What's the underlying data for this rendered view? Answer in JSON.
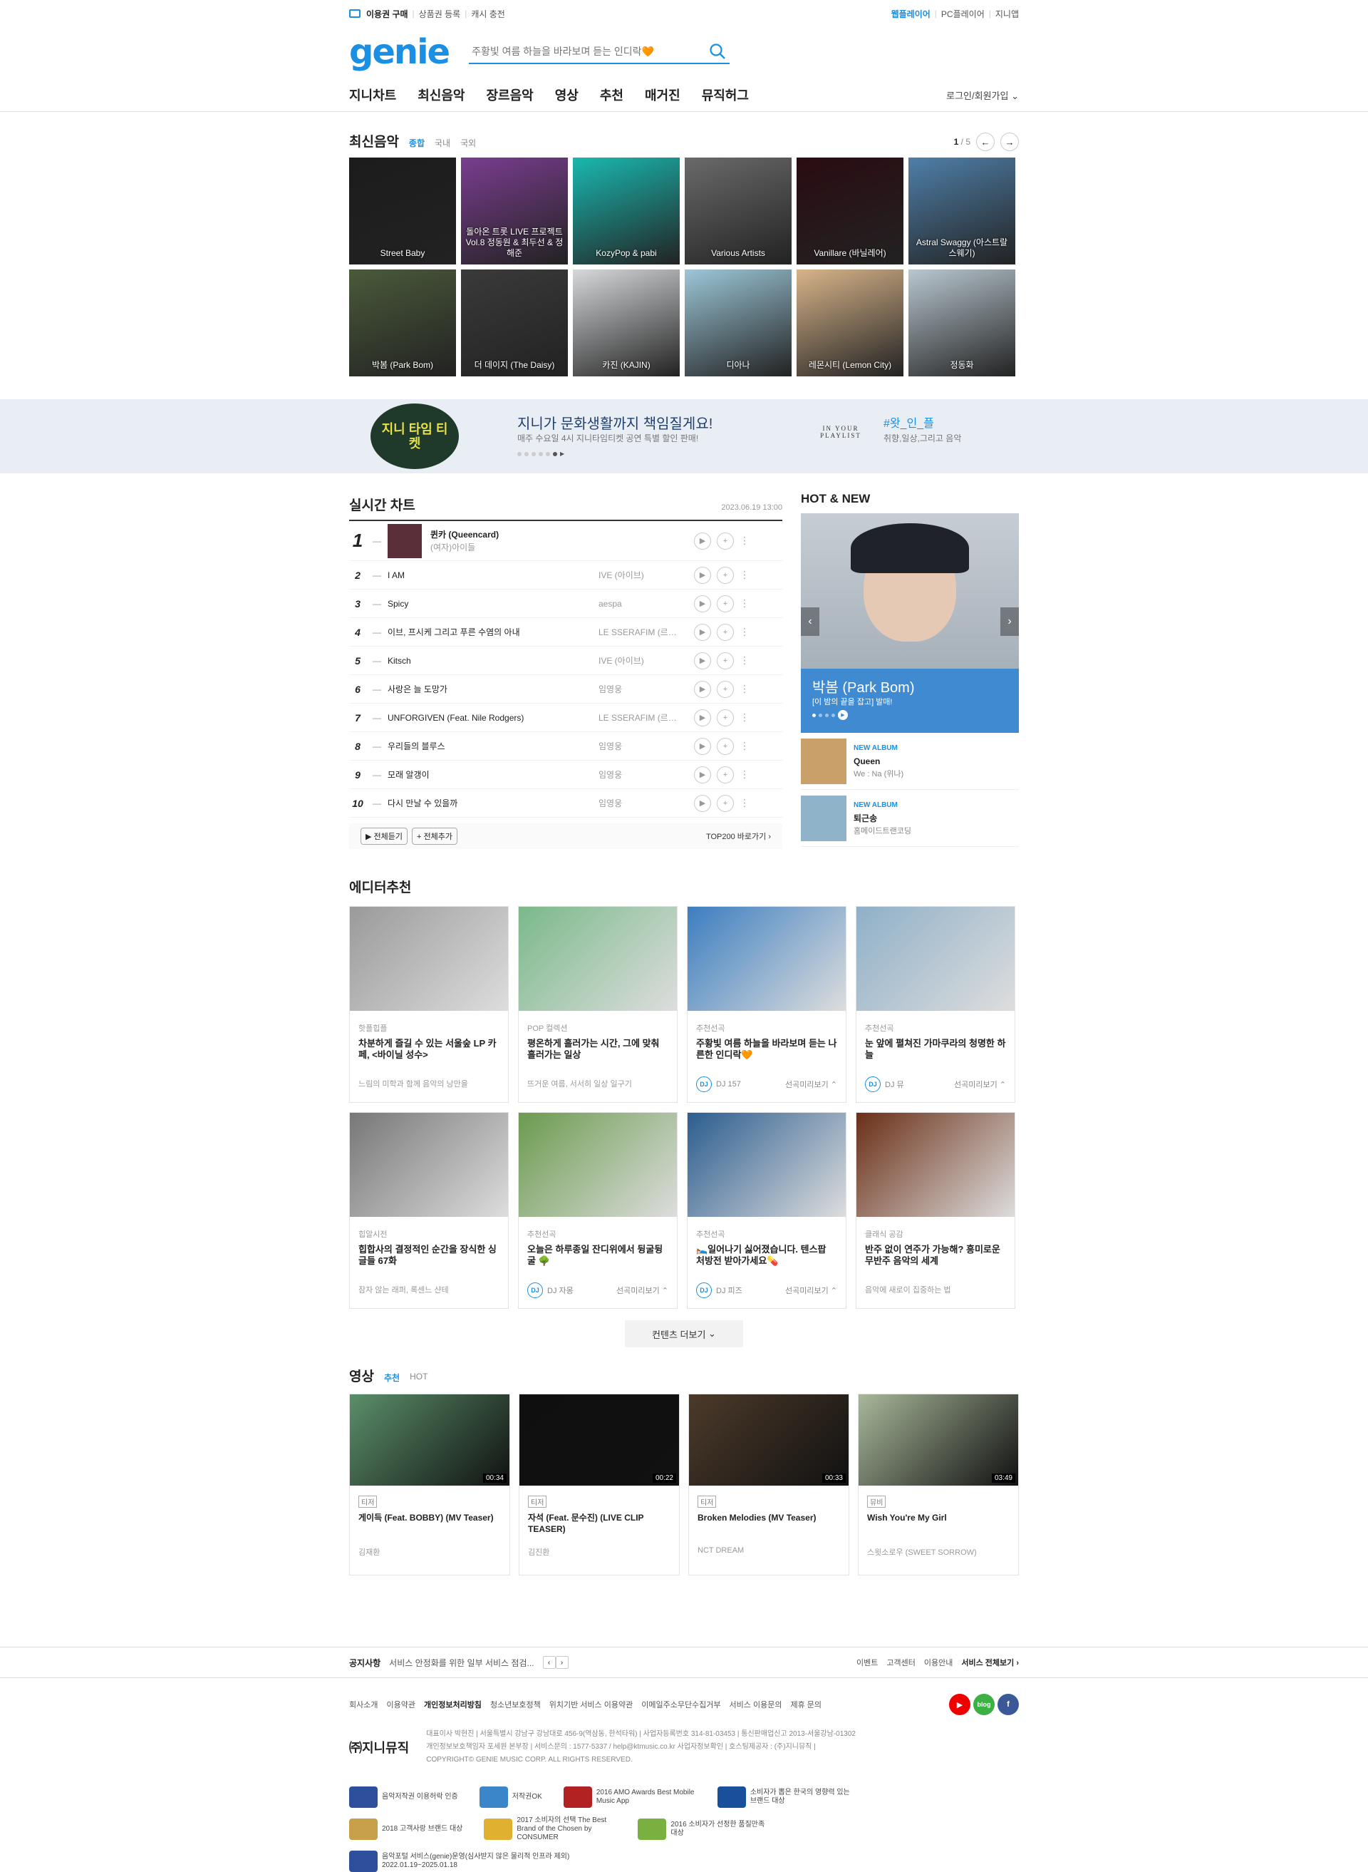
{
  "util": {
    "left": [
      "이용권 구매",
      "상품권 등록",
      "캐시 충전"
    ],
    "right": [
      "웹플레이어",
      "PC플레이어",
      "지니앱"
    ]
  },
  "logo": "genie",
  "search": {
    "placeholder": "주황빛 여름 하늘을 바라보며 듣는 인디락🧡"
  },
  "gnb": {
    "menu": [
      "지니차트",
      "최신음악",
      "장르음악",
      "영상",
      "추천",
      "매거진",
      "뮤직허그"
    ],
    "login": "로그인/회원가입"
  },
  "new_music": {
    "title": "최신음악",
    "tabs": [
      "종합",
      "국내",
      "국외"
    ],
    "page_current": "1",
    "page_total": "/ 5",
    "albums": [
      {
        "artist": "Street Baby",
        "color": "#1c1c1c"
      },
      {
        "artist": "돌아온 트롯 LIVE 프로젝트 Vol.8 정동원 & 최두선 & 정해준",
        "color": "#7a3d8f"
      },
      {
        "artist": "KozyPop & pabi",
        "color": "#1ab8b0"
      },
      {
        "artist": "Various Artists",
        "color": "#6a6a6a"
      },
      {
        "artist": "Vanillare (바닐레어)",
        "color": "#2a0c12"
      },
      {
        "artist": "Astral Swaggy (아스트랄 스웨기)",
        "color": "#4f7fa8"
      },
      {
        "artist": "박봄 (Park Bom)",
        "color": "#4a5a3a"
      },
      {
        "artist": "더 데이지 (The Daisy)",
        "color": "#3a3a3a"
      },
      {
        "artist": "카진 (KAJIN)",
        "color": "#d6d8da"
      },
      {
        "artist": "디아나",
        "color": "#9cc7d8"
      },
      {
        "artist": "레몬시티 (Lemon City)",
        "color": "#d8b48a"
      },
      {
        "artist": "정동화",
        "color": "#b9c7d0"
      }
    ]
  },
  "banner": {
    "left_title": "지니가 문화생활까지 책임질게요!",
    "left_sub": "매주 수요일 4시 지니타임티켓 공연 특별 할인 판매!",
    "badge": "지니 타임 티켓",
    "right_title": "#왓_인_플",
    "right_sub": "취향,일상,그리고 음악",
    "right_logo": "IN YOUR PLAYLIST"
  },
  "chart": {
    "title": "실시간 차트",
    "date": "2023.06.19 13:00",
    "rows": [
      {
        "rank": "1",
        "title": "퀸카 (Queencard)",
        "artist": "(여자)아이들"
      },
      {
        "rank": "2",
        "title": "I AM",
        "artist": "IVE (아이브)"
      },
      {
        "rank": "3",
        "title": "Spicy",
        "artist": "aespa"
      },
      {
        "rank": "4",
        "title": "이브, 프시케 그리고 푸른 수염의 아내",
        "artist": "LE SSERAFIM (르세라핌)"
      },
      {
        "rank": "5",
        "title": "Kitsch",
        "artist": "IVE (아이브)"
      },
      {
        "rank": "6",
        "title": "사랑은 늘 도망가",
        "artist": "임영웅"
      },
      {
        "rank": "7",
        "title": "UNFORGIVEN (Feat. Nile Rodgers)",
        "artist": "LE SSERAFIM (르세라핌)"
      },
      {
        "rank": "8",
        "title": "우리들의 블루스",
        "artist": "임영웅"
      },
      {
        "rank": "9",
        "title": "모래 알갱이",
        "artist": "임영웅"
      },
      {
        "rank": "10",
        "title": "다시 만날 수 있을까",
        "artist": "임영웅"
      }
    ],
    "dash": "—",
    "play_all": "전체듣기",
    "add_all": "전체추가",
    "top200": "TOP200 바로가기"
  },
  "hotnew": {
    "title": "HOT & NEW",
    "hero_artist": "박봄 (Park Bom)",
    "hero_sub": "[이 밤의 끝을 잡고] 발매!",
    "items": [
      {
        "label": "NEW ALBUM",
        "title": "Queen",
        "artist": "We : Na (위나)"
      },
      {
        "label": "NEW ALBUM",
        "title": "퇴근송",
        "artist": "홈메이드트랜코딩"
      }
    ]
  },
  "editor": {
    "title": "에디터추천",
    "cards": [
      {
        "cat": "핫플힙플",
        "title": "차분하게 즐길 수 있는 서울숲 LP 카페, <바이닐 성수>",
        "desc": "느림의 미학과 함께 음악의 낭만을",
        "dj": "",
        "more": "",
        "color": "#9a9a9a"
      },
      {
        "cat": "POP 컬렉션",
        "title": "평온하게 흘러가는 시간, 그에 맞춰 흘러가는 일상",
        "desc": "뜨거운 여름, 서서히 일상 일구기",
        "dj": "",
        "more": "",
        "color": "#7ab98a"
      },
      {
        "cat": "추천선곡",
        "title": "주황빛 여름 하늘을 바라보며 듣는 나른한 인디락🧡",
        "desc": "",
        "dj": "DJ 157",
        "more": "선곡미리보기",
        "color": "#3c7ec0"
      },
      {
        "cat": "추천선곡",
        "title": "눈 앞에 펼쳐진 가마쿠라의 청명한 하늘",
        "desc": "",
        "dj": "DJ 뮤",
        "more": "선곡미리보기",
        "color": "#8fb0c8"
      },
      {
        "cat": "힙알시전",
        "title": "힙합사의 결정적인 순간을 장식한 싱글들 67화",
        "desc": "잠자 않는 래퍼, 록센느 샨테",
        "dj": "",
        "more": "",
        "color": "#777777"
      },
      {
        "cat": "추천선곡",
        "title": "오늘은 하루종일 잔디위에서 뒹굴뒹굴 🌳",
        "desc": "",
        "dj": "DJ 자몽",
        "more": "선곡미리보기",
        "color": "#6b9b4f"
      },
      {
        "cat": "추천선곡",
        "title": "🛌일어나기 싫어졌습니다. 텐스팝 처방전 받아가세요💊",
        "desc": "",
        "dj": "DJ 피즈",
        "more": "선곡미리보기",
        "color": "#2b5d8f"
      },
      {
        "cat": "클래식 공감",
        "title": "반주 없이 연주가 가능해? 흥미로운 무반주 음악의 세계",
        "desc": "음악에 새로이 집중하는 법",
        "dj": "",
        "more": "",
        "color": "#6a2f16"
      }
    ],
    "more_btn": "컨텐츠 더보기"
  },
  "video": {
    "title": "영상",
    "tabs": [
      "추천",
      "HOT"
    ],
    "items": [
      {
        "tag": "티저",
        "title": "게이득 (Feat. BOBBY) (MV Teaser)",
        "artist": "김재환",
        "dur": "00:34",
        "color": "#5a8f6a"
      },
      {
        "tag": "티저",
        "title": "자석 (Feat. 문수진) (LIVE CLIP TEASER)",
        "artist": "김진환",
        "dur": "00:22",
        "color": "#0f0f0f"
      },
      {
        "tag": "티저",
        "title": "Broken Melodies (MV Teaser)",
        "artist": "NCT DREAM",
        "dur": "00:33",
        "color": "#4c3a2a"
      },
      {
        "tag": "뮤비",
        "title": "Wish You're My Girl",
        "artist": "스윗소로우 (SWEET SORROW)",
        "dur": "03:49",
        "color": "#a8b89a"
      }
    ]
  },
  "notice": {
    "label": "공지사항",
    "text": "서비스 안정화를 위한 일부 서비스 점검...",
    "links": [
      "이벤트",
      "고객센터",
      "이용안내",
      "서비스 전체보기"
    ]
  },
  "footer": {
    "links": [
      "회사소개",
      "이용약관",
      "개인정보처리방침",
      "청소년보호정책",
      "위치기반 서비스 이용약관",
      "이메일주소무단수집거부",
      "서비스 이용문의",
      "제휴 문의"
    ],
    "company": "㈜지니뮤직",
    "info1": "대표이사 박현진  |  서울특별시 강남구 강남대로 456-9(역삼동, 한석타워)  |  사업자등록번호 314-81-03453  |  통신판매업신고 2013-서울강남-01302",
    "info2": "개인정보보호책임자 포세원 본부장  |  서비스문의 : 1577-5337 / help@ktmusic.co.kr  사업자정보확인  |  호스팅제공자 : (주)지니뮤직  |",
    "copyright": "COPYRIGHT© GENIE MUSIC CORP. ALL RIGHTS RESERVED.",
    "sns": [
      "YouTube",
      "blog",
      "f"
    ],
    "certs": [
      {
        "text": "음악저작권 이용허락 인증",
        "color": "#2d4f9c"
      },
      {
        "text": "저작권OK",
        "color": "#3a86c8"
      },
      {
        "text": "2016 AMO Awards Best Mobile Music App",
        "color": "#b22222"
      },
      {
        "text": "소비자가 뽑은 한국의 영향력 있는 브랜드 대상",
        "color": "#1a4f9c"
      },
      {
        "text": "2018 고객사랑 브랜드 대상",
        "color": "#c8a04a"
      },
      {
        "text": "2017 소비자의 선택 The Best Brand of the Chosen by CONSUMER",
        "color": "#e0b030"
      },
      {
        "text": "2016 소비자가 선정한 품질만족대상",
        "color": "#7ab040"
      },
      {
        "text": "음악포털 서비스(genie)운영(심사받지 않은 물리적 인프라 제외) 2022.01.19~2025.01.18",
        "color": "#2d4f9c"
      }
    ]
  }
}
